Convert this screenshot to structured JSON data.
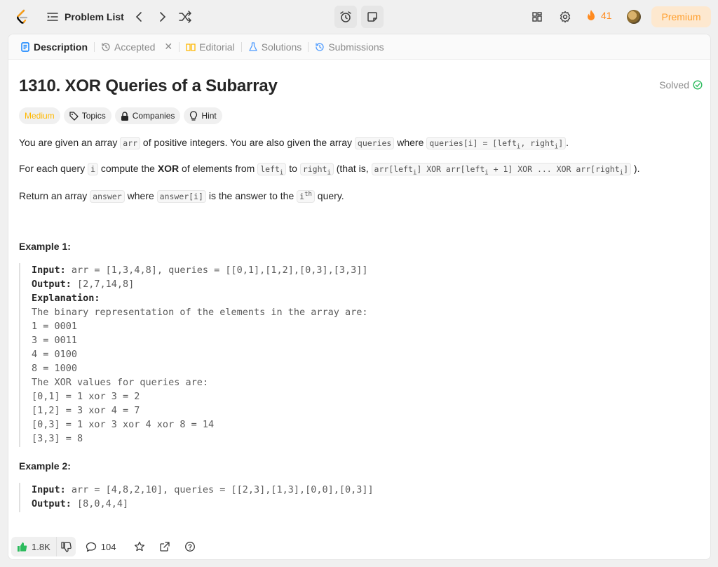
{
  "nav": {
    "problem_list": "Problem List",
    "streak": "41",
    "premium": "Premium"
  },
  "tabs": [
    {
      "label": "Description"
    },
    {
      "label": "Accepted"
    },
    {
      "label": "Editorial"
    },
    {
      "label": "Solutions"
    },
    {
      "label": "Submissions"
    }
  ],
  "problem": {
    "title": "1310. XOR Queries of a Subarray",
    "status": "Solved",
    "difficulty": "Medium",
    "tags": [
      "Topics",
      "Companies",
      "Hint"
    ]
  },
  "description": {
    "p1": [
      "You are given an array ",
      "arr",
      " of positive integers. You are also given the array ",
      "queries",
      " where ",
      "queries[i] = [left",
      "i",
      ", right",
      "i",
      "]",
      "."
    ],
    "p2": [
      "For each query ",
      "i",
      " compute the ",
      "XOR",
      " of elements from ",
      "left",
      "i",
      " to ",
      "right",
      "i",
      " (that is, ",
      "arr[left",
      "i",
      "] XOR arr[left",
      "i",
      " + 1] XOR ... XOR arr[right",
      "i",
      "]",
      " )."
    ],
    "p3": [
      "Return an array ",
      "answer",
      " where ",
      "answer[i]",
      " is the answer to the ",
      "i",
      "th",
      " query."
    ]
  },
  "examples": [
    {
      "title": "Example 1:",
      "input_label": "Input:",
      "input": " arr = [1,3,4,8], queries = [[0,1],[1,2],[0,3],[3,3]]",
      "output_label": "Output:",
      "output": " [2,7,14,8]",
      "explanation_label": "Explanation:",
      "explanation": [
        "The binary representation of the elements in the array are:",
        "1 = 0001",
        "3 = 0011",
        "4 = 0100",
        "8 = 1000",
        "The XOR values for queries are:",
        "[0,1] = 1 xor 3 = 2",
        "[1,2] = 3 xor 4 = 7",
        "[0,3] = 1 xor 3 xor 4 xor 8 = 14",
        "[3,3] = 8"
      ]
    },
    {
      "title": "Example 2:",
      "input_label": "Input:",
      "input": " arr = [4,8,2,10], queries = [[2,3],[1,3],[0,0],[0,3]]",
      "output_label": "Output:",
      "output": " [8,0,4,4]"
    }
  ],
  "footer": {
    "likes": "1.8K",
    "comments": "104"
  },
  "colors": {
    "medium": "#ffb800",
    "solved": "#2cbb5d",
    "accent_premium": "#ff9f2e",
    "streak": "#ff8a1e"
  }
}
